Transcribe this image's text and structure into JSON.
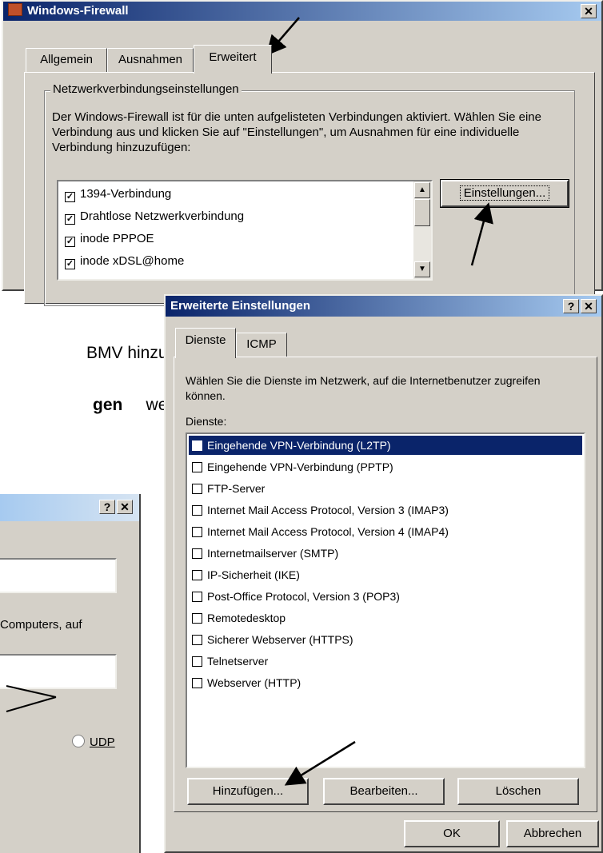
{
  "firewall_window": {
    "title": "Windows-Firewall",
    "close_glyph": "✕",
    "tabs": [
      "Allgemein",
      "Ausnahmen",
      "Erweitert"
    ],
    "group_label": "Netzwerkverbindungseinstellungen",
    "description": "Der Windows-Firewall ist für die unten aufgelisteten Verbindungen aktiviert. Wählen Sie eine Verbindung aus und klicken Sie auf \"Einstellungen\", um Ausnahmen für eine individuelle Verbindung hinzuzufügen:",
    "connections": [
      {
        "label": "1394-Verbindung",
        "checked": true
      },
      {
        "label": "Drahtlose Netzwerkverbindung",
        "checked": true
      },
      {
        "label": "inode PPPOE",
        "checked": true
      },
      {
        "label": "inode xDSL@home",
        "checked": true
      }
    ],
    "settings_button": "Einstellungen..."
  },
  "advanced_window": {
    "title": "Erweiterte Einstellungen",
    "help_glyph": "?",
    "close_glyph": "✕",
    "tabs": [
      "Dienste",
      "ICMP"
    ],
    "description": "Wählen Sie die Dienste im Netzwerk, auf die Internetbenutzer zugreifen können.",
    "services_label": "Dienste:",
    "services": [
      {
        "label": "Eingehende VPN-Verbindung (L2TP)",
        "checked": false,
        "selected": true
      },
      {
        "label": "Eingehende VPN-Verbindung (PPTP)",
        "checked": false
      },
      {
        "label": "FTP-Server",
        "checked": false
      },
      {
        "label": "Internet Mail Access Protocol, Version 3 (IMAP3)",
        "checked": false
      },
      {
        "label": "Internet Mail Access Protocol, Version 4 (IMAP4)",
        "checked": false
      },
      {
        "label": "Internetmailserver (SMTP)",
        "checked": false
      },
      {
        "label": "IP-Sicherheit (IKE)",
        "checked": false
      },
      {
        "label": "Post-Office Protocol, Version 3 (POP3)",
        "checked": false
      },
      {
        "label": "Remotedesktop",
        "checked": false
      },
      {
        "label": "Sicherer Webserver (HTTPS)",
        "checked": false
      },
      {
        "label": "Telnetserver",
        "checked": false
      },
      {
        "label": "Webserver (HTTP)",
        "checked": false
      }
    ],
    "buttons": {
      "add": "Hinzufügen...",
      "edit": "Bearbeiten...",
      "delete": "Löschen",
      "ok": "OK",
      "cancel": "Abbrechen"
    }
  },
  "background_text": {
    "line1": "BMV hinzu-",
    "line2_bold": "gen",
    "line2_rest": "werden"
  },
  "partial_dialog": {
    "help_glyph": "?",
    "close_glyph": "✕",
    "computers_text": "Computers, auf",
    "udp_label": "UDP"
  },
  "colors": {
    "dialog_face": "#d4d0c8",
    "title_start": "#0a246a",
    "title_end": "#a6caf0",
    "selection": "#0a246a"
  }
}
